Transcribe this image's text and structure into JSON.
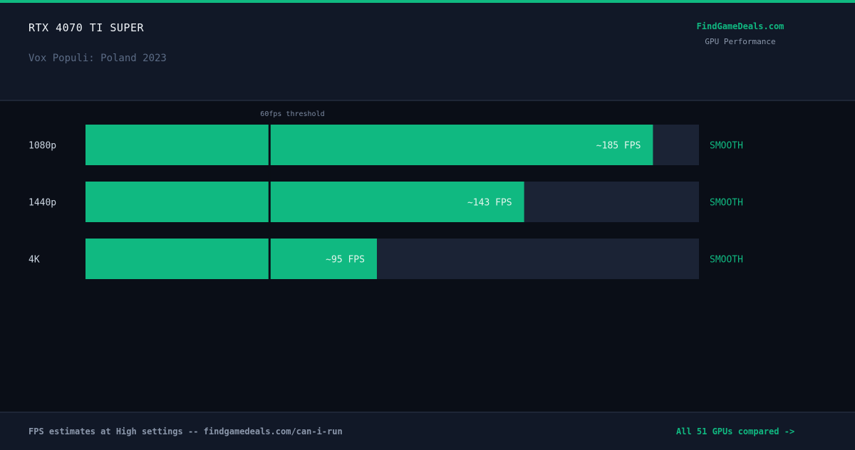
{
  "header": {
    "title": "RTX 4070 TI SUPER",
    "subtitle": "Vox Populi: Poland 2023",
    "brand": "FindGameDeals.com",
    "brand_tagline": "GPU Performance"
  },
  "chart_data": {
    "type": "bar",
    "orientation": "horizontal",
    "categories": [
      "1080p",
      "1440p",
      "4K"
    ],
    "values": [
      185,
      143,
      95
    ],
    "value_labels": [
      "~185 FPS",
      "~143 FPS",
      "~95 FPS"
    ],
    "status_labels": [
      "SMOOTH",
      "SMOOTH",
      "SMOOTH"
    ],
    "xlim": [
      0,
      200
    ],
    "threshold": {
      "value": 60,
      "label": "60fps threshold"
    },
    "title": "",
    "xlabel": "",
    "ylabel": "",
    "grid": false,
    "legend": "none",
    "colors": {
      "bar": "#10b981",
      "track": "#1b2335",
      "threshold_line": "#0a0e17",
      "status": "#10b981"
    }
  },
  "footer": {
    "note": "FPS estimates at High settings -- findgamedeals.com/can-i-run",
    "link": "All 51 GPUs compared ->"
  }
}
